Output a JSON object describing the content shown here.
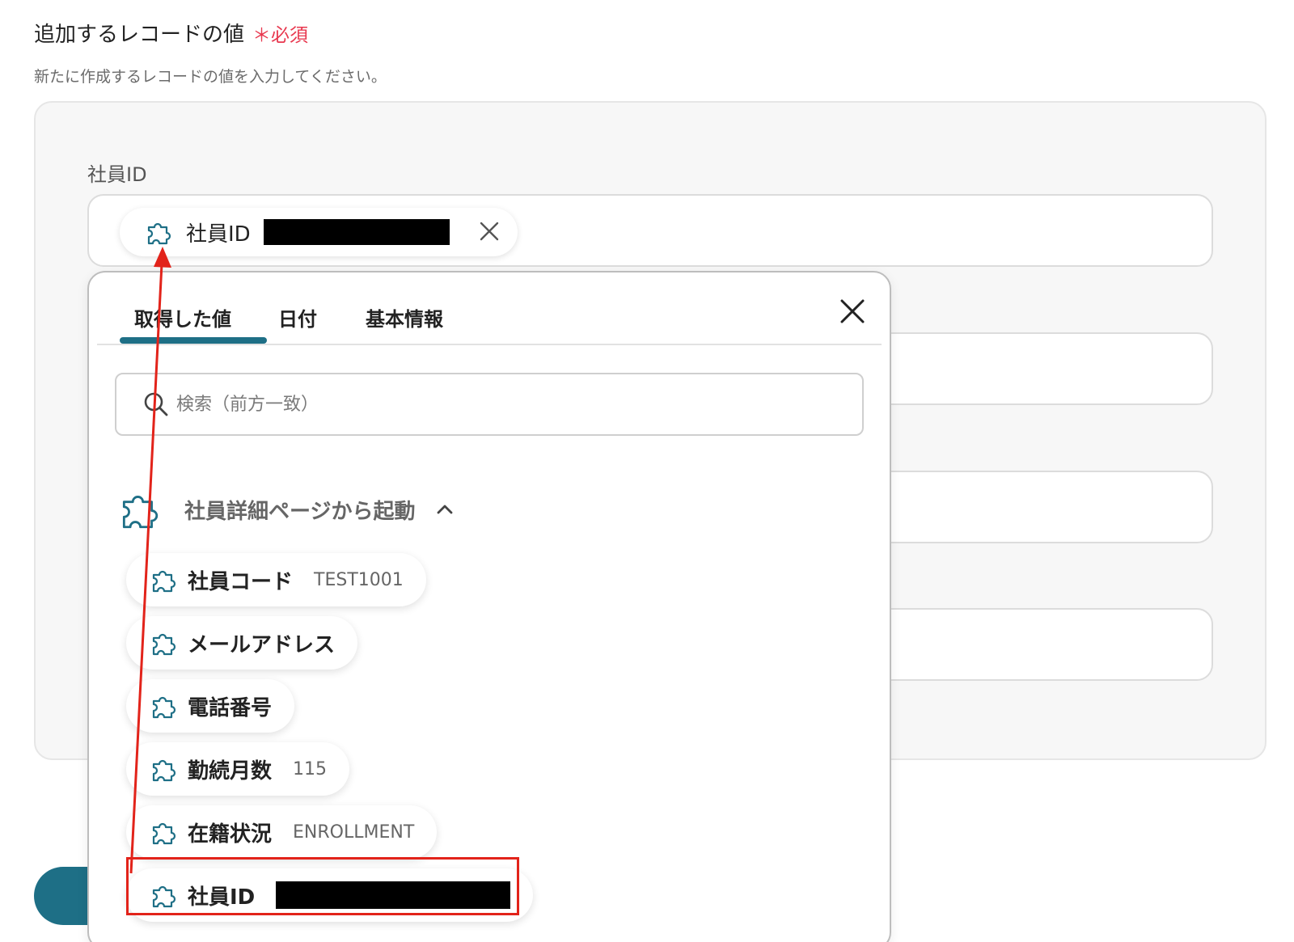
{
  "section": {
    "title": "追加するレコードの値",
    "required_mark": "＊必須",
    "description": "新たに作成するレコードの値を入力してください。"
  },
  "field": {
    "label": "社員ID",
    "chip_label": "社員ID"
  },
  "popover": {
    "tabs": [
      {
        "label": "取得した値",
        "active": true
      },
      {
        "label": "日付",
        "active": false
      },
      {
        "label": "基本情報",
        "active": false
      }
    ],
    "search_placeholder": "検索（前方一致）",
    "group": {
      "label": "社員詳細ページから起動",
      "items": [
        {
          "label": "社員コード",
          "value": "TEST1001"
        },
        {
          "label": "メールアドレス",
          "value": ""
        },
        {
          "label": "電話番号",
          "value": ""
        },
        {
          "label": "勤続月数",
          "value": "115"
        },
        {
          "label": "在籍状況",
          "value": "ENROLLMENT"
        },
        {
          "label": "社員ID",
          "value": ""
        }
      ]
    }
  },
  "colors": {
    "accent": "#1e6f86",
    "required": "#e8384f",
    "annotation": "#e2231a"
  },
  "icons": {
    "chip_icon": "puzzle-icon",
    "close": "close-icon",
    "search": "search-icon",
    "chevron": "chevron-up-icon"
  }
}
